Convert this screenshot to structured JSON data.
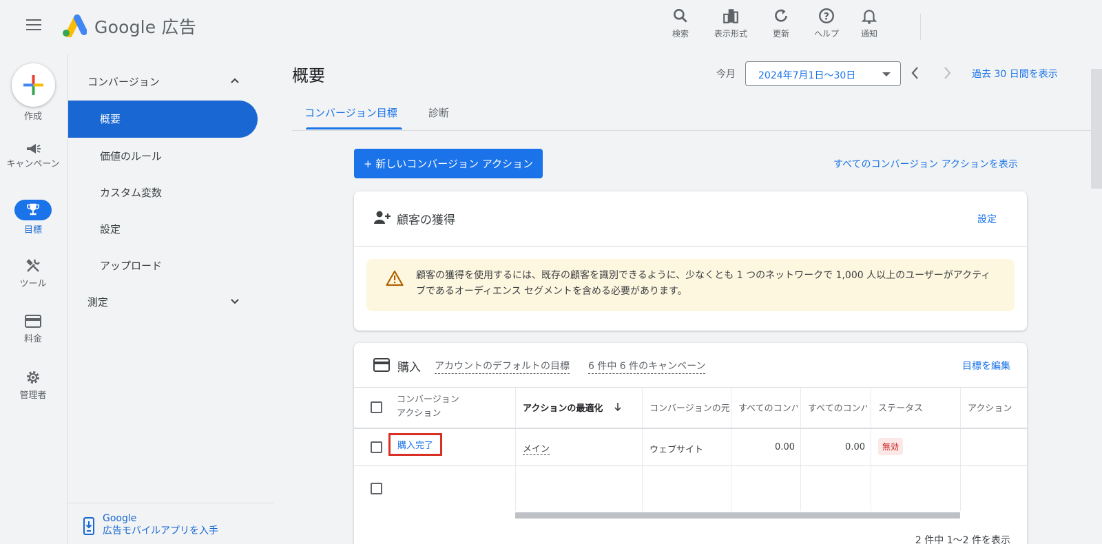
{
  "header": {
    "brand": "Google 広告",
    "actions": [
      {
        "name": "search",
        "label": "検索",
        "icon": "search-icon"
      },
      {
        "name": "display",
        "label": "表示形式",
        "icon": "display-format-icon"
      },
      {
        "name": "refresh",
        "label": "更新",
        "icon": "refresh-icon"
      },
      {
        "name": "help",
        "label": "ヘルプ",
        "icon": "help-icon"
      },
      {
        "name": "notifications",
        "label": "通知",
        "icon": "bell-icon"
      }
    ]
  },
  "rail": {
    "create": "作成",
    "campaign": "キャンペーン",
    "goals": "目標",
    "tools": "ツール",
    "billing": "料金",
    "admin": "管理者"
  },
  "sidenav": {
    "section1": "コンバージョン",
    "items": [
      "概要",
      "価値のルール",
      "カスタム変数",
      "設定",
      "アップロード"
    ],
    "section2": "測定",
    "mobile_line1": "Google",
    "mobile_line2": "広告モバイルアプリを入手"
  },
  "main": {
    "title": "概要",
    "date_label": "今月",
    "date_range": "2024年7月1日～30日",
    "past30": "過去 30 日間を表示",
    "tabs": [
      "コンバージョン目標",
      "診断"
    ],
    "new_action": "+ 新しいコンバージョン アクション",
    "view_all": "すべてのコンバージョン アクションを表示"
  },
  "acquisition": {
    "title": "顧客の獲得",
    "settings": "設定",
    "warning": "顧客の獲得を使用するには、既存の顧客を識別できるように、少なくとも 1 つのネットワークで 1,000 人以上のユーザーがアクティブであるオーディエンス セグメントを含める必要があります。"
  },
  "purchase": {
    "title": "購入",
    "default_goal": "アカウントのデフォルトの目標",
    "campaigns": "6 件中 6 件のキャンペーン",
    "edit": "目標を編集",
    "columns": [
      "コンバージョン\nアクション",
      "アクションの最適化",
      "コンバージョンの元",
      "すべてのコンバ",
      "すべてのコンバ",
      "ステータス",
      "アクション"
    ],
    "rows": [
      {
        "action": "購入完了",
        "optimization": "メイン",
        "source": "ウェブサイト",
        "all_conv1": "0.00",
        "all_conv2": "0.00",
        "status": "無効"
      }
    ],
    "pager": "2 件中 1～2 件を表示"
  },
  "colors": {
    "accent": "#1a73e8",
    "warning_bg": "#fef7e0",
    "status_bg": "#fce8e6",
    "highlight_border": "#d93025"
  }
}
